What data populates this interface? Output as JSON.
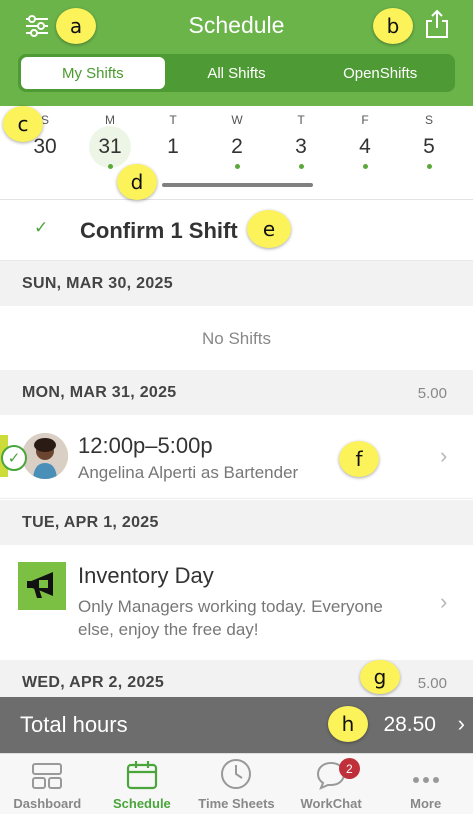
{
  "header": {
    "title": "Schedule",
    "filter_icon": "sliders-icon",
    "share_icon": "share-icon",
    "color": "#6bb44a"
  },
  "segments": [
    {
      "label": "My Shifts",
      "active": true
    },
    {
      "label": "All Shifts",
      "active": false
    },
    {
      "label": "OpenShifts",
      "active": false
    }
  ],
  "week": [
    {
      "dow": "S",
      "num": "30",
      "dot": false,
      "today": false
    },
    {
      "dow": "M",
      "num": "31",
      "dot": true,
      "today": true
    },
    {
      "dow": "T",
      "num": "1",
      "dot": false,
      "today": false
    },
    {
      "dow": "W",
      "num": "2",
      "dot": true,
      "today": false
    },
    {
      "dow": "T",
      "num": "3",
      "dot": true,
      "today": false
    },
    {
      "dow": "F",
      "num": "4",
      "dot": true,
      "today": false
    },
    {
      "dow": "S",
      "num": "5",
      "dot": true,
      "today": false
    }
  ],
  "confirm": {
    "label": "Confirm 1 Shift"
  },
  "days": {
    "sun": {
      "date": "SUN, MAR 30, 2025",
      "hours": "",
      "empty": "No Shifts"
    },
    "mon": {
      "date": "MON, MAR 31, 2025",
      "hours": "5.00"
    },
    "tue": {
      "date": "TUE, APR 1, 2025",
      "hours": ""
    },
    "wed": {
      "date": "WED, APR 2, 2025",
      "hours": "5.00"
    }
  },
  "shift": {
    "time": "12:00p–5:00p",
    "subtitle": "Angelina Alperti as Bartender"
  },
  "announcement": {
    "title": "Inventory Day",
    "body": "Only Managers working today. Everyone else, enjoy the free day!"
  },
  "total": {
    "label": "Total hours",
    "value": "28.50"
  },
  "tabs": [
    {
      "label": "Dashboard",
      "icon": "dashboard-icon"
    },
    {
      "label": "Schedule",
      "icon": "calendar-icon",
      "active": true
    },
    {
      "label": "Time Sheets",
      "icon": "clock-icon"
    },
    {
      "label": "WorkChat",
      "icon": "chat-icon",
      "badge": "2"
    },
    {
      "label": "More",
      "icon": "more-icon"
    }
  ],
  "markers": [
    "a",
    "b",
    "c",
    "d",
    "e",
    "f",
    "g",
    "h"
  ]
}
